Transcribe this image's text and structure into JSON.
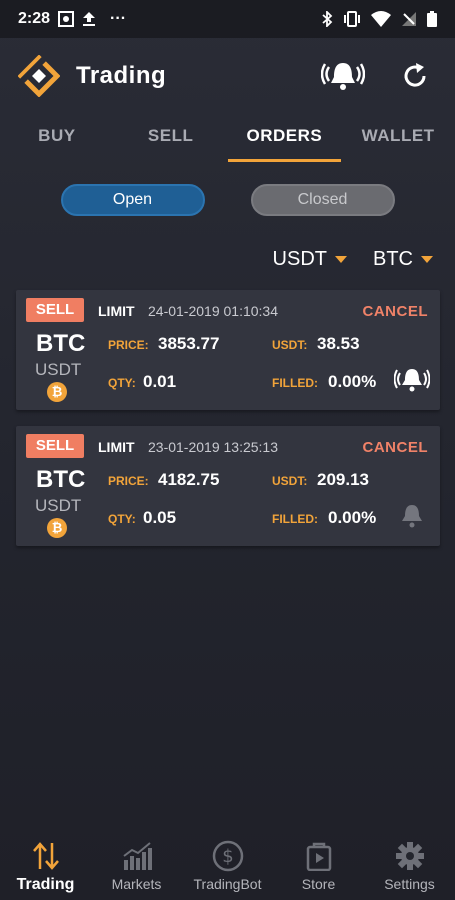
{
  "status_bar": {
    "time": "2:28",
    "more": "···"
  },
  "header": {
    "title": "Trading"
  },
  "tabs": [
    {
      "label": "BUY",
      "active": false
    },
    {
      "label": "SELL",
      "active": false
    },
    {
      "label": "ORDERS",
      "active": true
    },
    {
      "label": "WALLET",
      "active": false
    }
  ],
  "filters": {
    "open_label": "Open",
    "closed_label": "Closed",
    "selected": "Open"
  },
  "selectors": {
    "quote": "USDT",
    "base": "BTC"
  },
  "orders": [
    {
      "side": "SELL",
      "type": "LIMIT",
      "date": "24-01-2019 01:10:34",
      "cancel": "CANCEL",
      "base": "BTC",
      "quote": "USDT",
      "coin_glyph": "₿",
      "price_label": "PRICE:",
      "price": "3853.77",
      "total_label": "USDT:",
      "total": "38.53",
      "qty_label": "QTY:",
      "qty": "0.01",
      "filled_label": "FILLED:",
      "filled": "0.00%",
      "alert": "ringing-bell-icon"
    },
    {
      "side": "SELL",
      "type": "LIMIT",
      "date": "23-01-2019 13:25:13",
      "cancel": "CANCEL",
      "base": "BTC",
      "quote": "USDT",
      "coin_glyph": "₿",
      "price_label": "PRICE:",
      "price": "4182.75",
      "total_label": "USDT:",
      "total": "209.13",
      "qty_label": "QTY:",
      "qty": "0.05",
      "filled_label": "FILLED:",
      "filled": "0.00%",
      "alert": "bell-icon"
    }
  ],
  "bottom_nav": [
    {
      "label": "Trading",
      "icon": "trading-arrows-icon",
      "active": true
    },
    {
      "label": "Markets",
      "icon": "markets-chart-icon",
      "active": false
    },
    {
      "label": "TradingBot",
      "icon": "dollar-circle-icon",
      "active": false
    },
    {
      "label": "Store",
      "icon": "store-bag-icon",
      "active": false
    },
    {
      "label": "Settings",
      "icon": "gear-icon",
      "active": false
    }
  ],
  "colors": {
    "accent": "#f2a43a",
    "sell": "#f07e62",
    "open_pill": "#1f5f95",
    "card": "#33353f"
  }
}
